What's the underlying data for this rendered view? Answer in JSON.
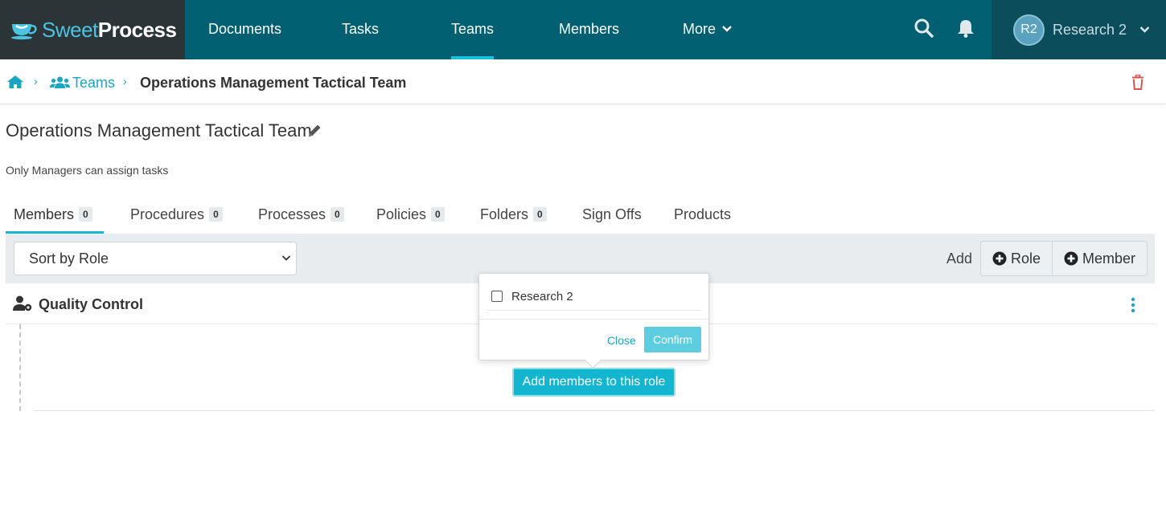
{
  "brand": {
    "part1": "Sweet",
    "part2": "Process"
  },
  "nav": {
    "documents": "Documents",
    "tasks": "Tasks",
    "teams": "Teams",
    "members": "Members",
    "more": "More"
  },
  "user": {
    "initials": "R2",
    "name": "Research 2"
  },
  "breadcrumb": {
    "teams": "Teams",
    "current": "Operations Management Tactical Team"
  },
  "header": {
    "title": "Operations Management Tactical Team",
    "subtitle": "Only Managers can assign tasks"
  },
  "tabs": [
    {
      "label": "Members",
      "count": "0"
    },
    {
      "label": "Procedures",
      "count": "0"
    },
    {
      "label": "Processes",
      "count": "0"
    },
    {
      "label": "Policies",
      "count": "0"
    },
    {
      "label": "Folders",
      "count": "0"
    },
    {
      "label": "Sign Offs"
    },
    {
      "label": "Products"
    }
  ],
  "toolbar": {
    "sort_value": "Sort by Role",
    "add_label": "Add",
    "role_button": "Role",
    "member_button": "Member"
  },
  "role": {
    "name": "Quality Control",
    "add_members_button": "Add members to this role"
  },
  "popover": {
    "option": "Research 2",
    "close": "Close",
    "confirm": "Confirm"
  },
  "colors": {
    "nav_bg": "#005f70",
    "brand_bg": "#2b3437",
    "accent": "#19b6cf",
    "link": "#1aa6c1",
    "danger": "#d9534f"
  }
}
